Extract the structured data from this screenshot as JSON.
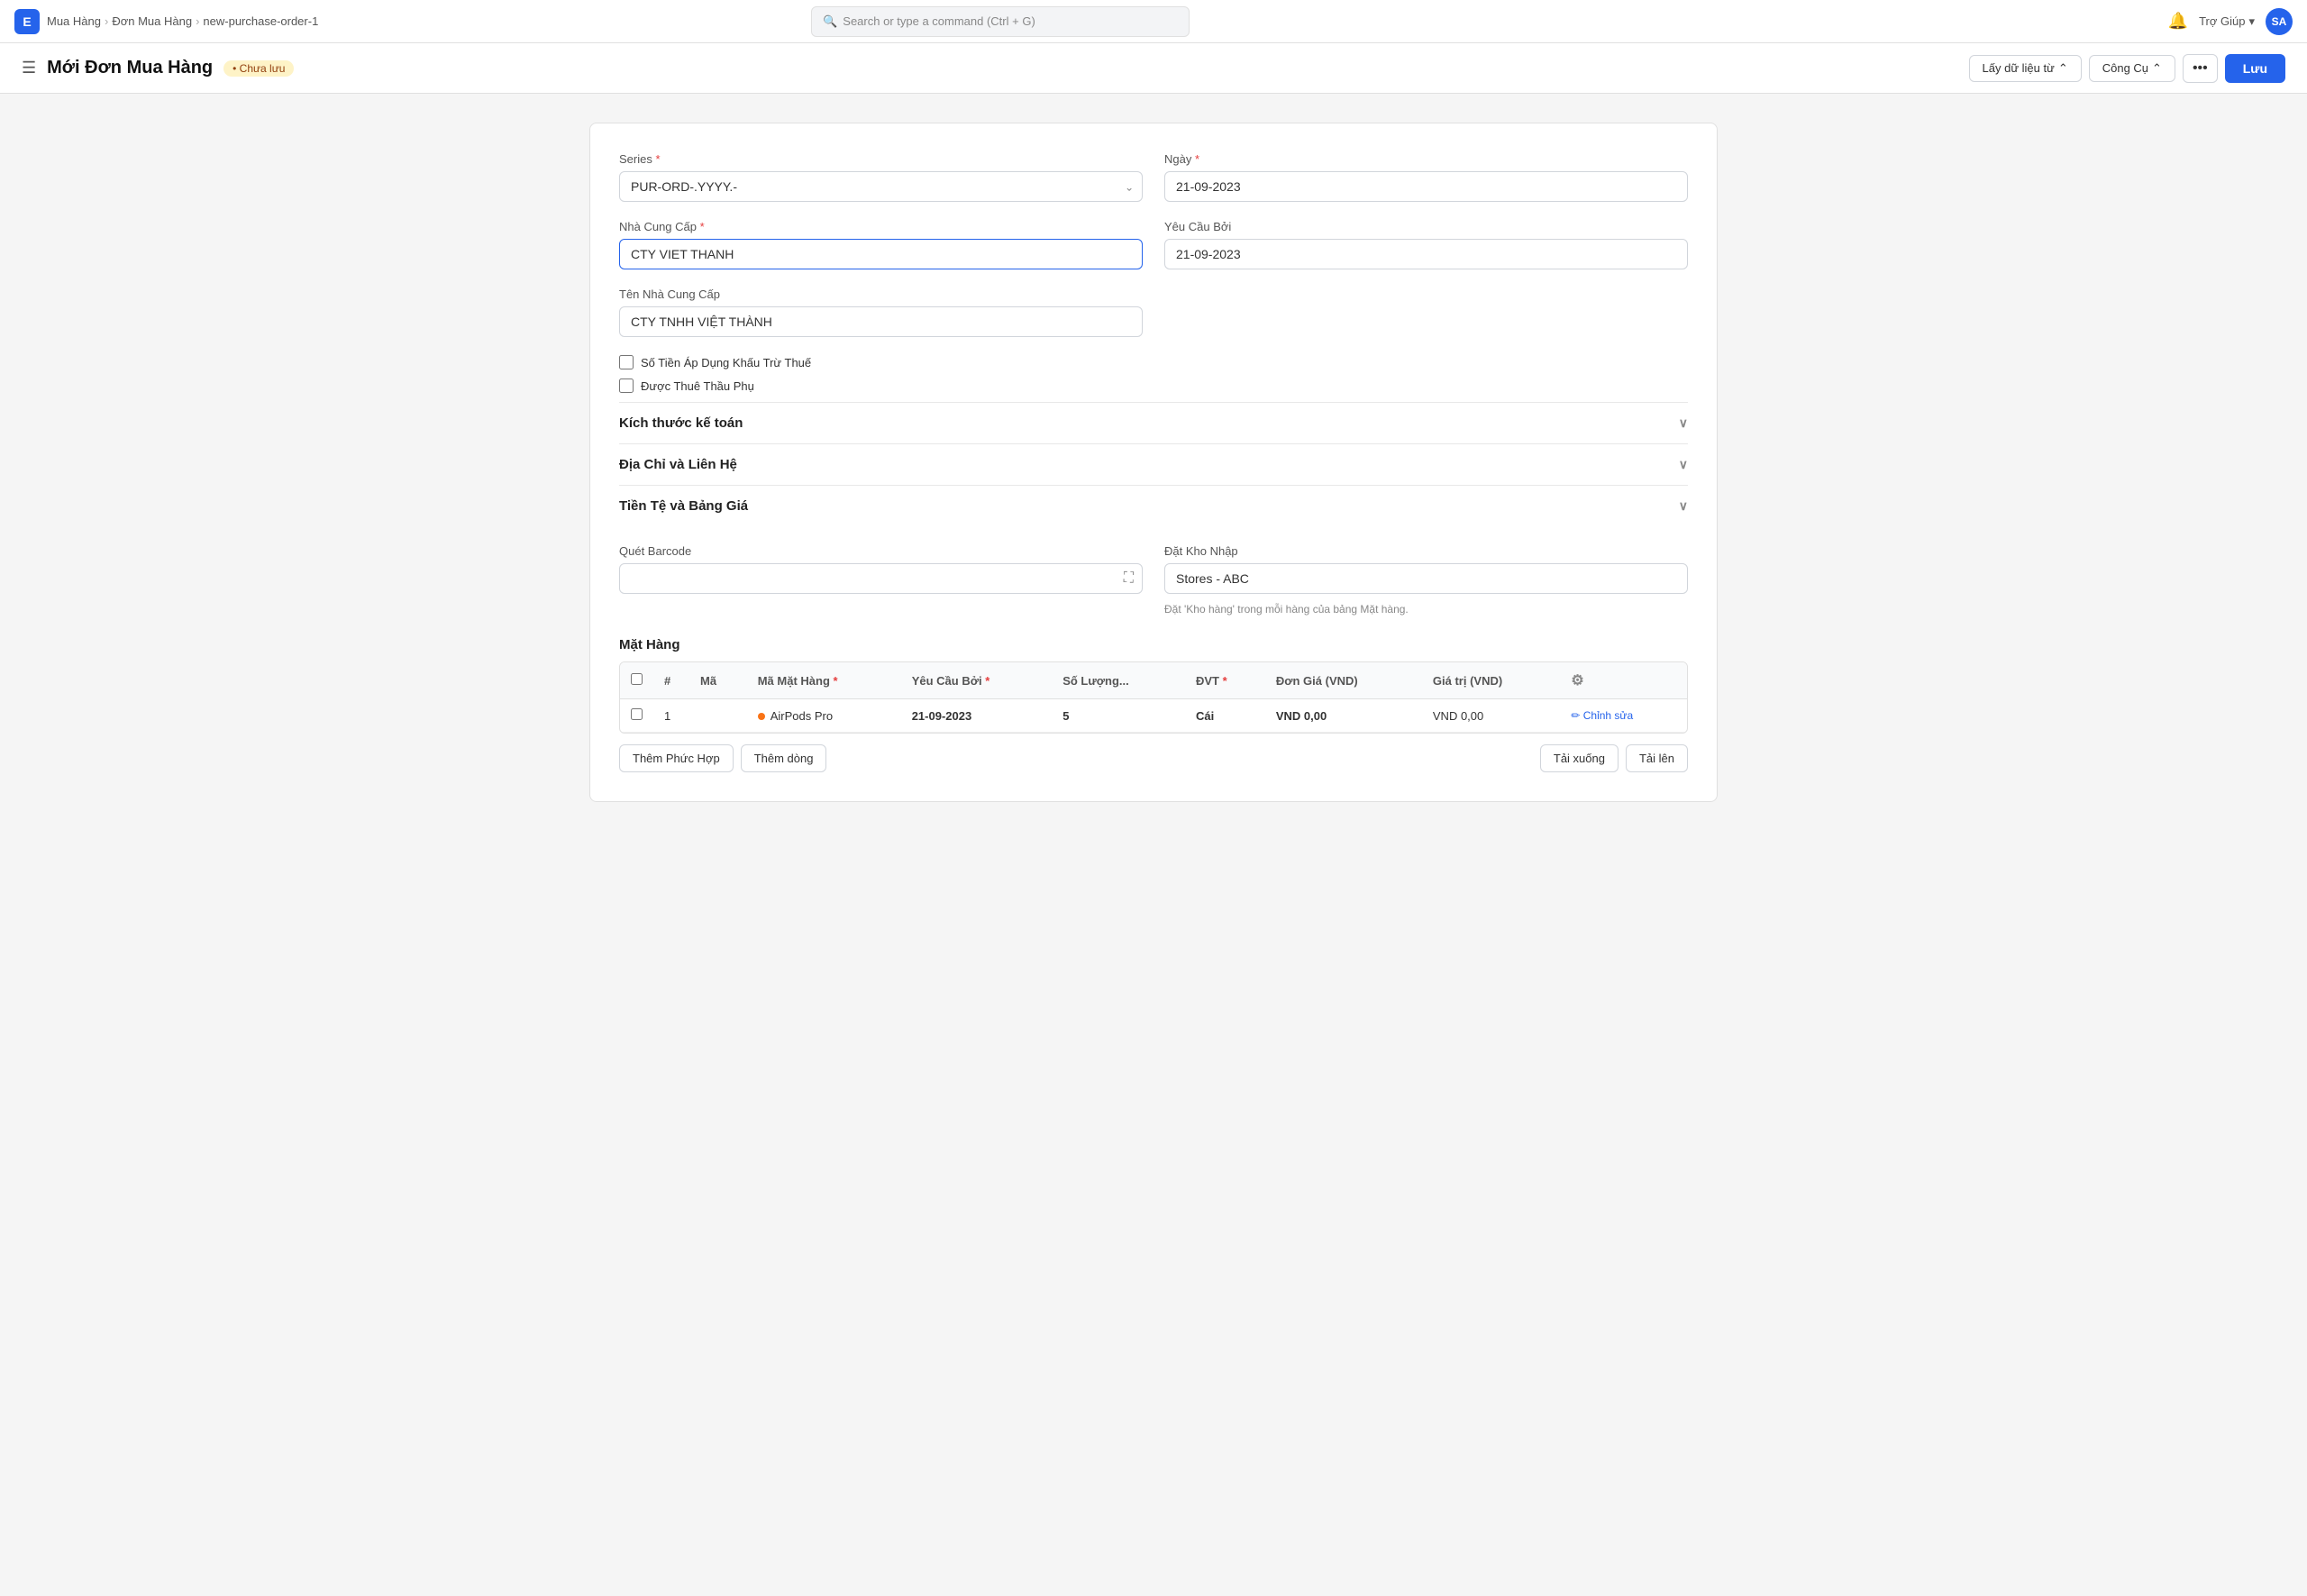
{
  "nav": {
    "logo": "E",
    "breadcrumbs": [
      "Mua Hàng",
      "Đơn Mua Hàng",
      "new-purchase-order-1"
    ],
    "search_placeholder": "Search or type a command (Ctrl + G)",
    "help_label": "Trợ Giúp",
    "avatar_initials": "SA"
  },
  "header": {
    "menu_icon": "☰",
    "title": "Mới Đơn Mua Hàng",
    "unsaved": "• Chưa lưu",
    "btn_data": "Lấy dữ liệu từ",
    "btn_tools": "Công Cụ",
    "btn_dots": "•••",
    "btn_save": "Lưu"
  },
  "form": {
    "series_label": "Series",
    "series_value": "PUR-ORD-.YYYY.-",
    "ngay_label": "Ngày",
    "ngay_value": "21-09-2023",
    "nha_cung_cap_label": "Nhà Cung Cấp",
    "nha_cung_cap_value": "CTY VIET THANH",
    "yeu_cau_boi_label": "Yêu Cầu Bởi",
    "yeu_cau_boi_value": "21-09-2023",
    "ten_ncc_label": "Tên Nhà Cung Cấp",
    "ten_ncc_value": "CTY TNHH VIỆT THÀNH",
    "checkbox1_label": "Số Tiền Áp Dụng Khấu Trừ Thuế",
    "checkbox2_label": "Được Thuê Thầu Phụ",
    "section1": "Kích thước kế toán",
    "section2": "Địa Chỉ và Liên Hệ",
    "section3": "Tiền Tệ và Bảng Giá",
    "barcode_label": "Quét Barcode",
    "barcode_placeholder": "",
    "kho_nhap_label": "Đặt Kho Nhập",
    "kho_nhap_value": "Stores - ABC",
    "kho_hint": "Đặt 'Kho hàng' trong mỗi hàng của bảng Mặt hàng.",
    "mat_hang_label": "Mặt Hàng"
  },
  "table": {
    "columns": [
      "",
      "#",
      "Mã",
      "Mã Mặt Hàng",
      "Yêu Cầu Bởi",
      "Số Lượng...",
      "ĐVT",
      "Đơn Giá (VND)",
      "Giá trị (VND)",
      ""
    ],
    "rows": [
      {
        "num": "1",
        "ma": "",
        "ma_mat_hang": "AirPods Pro",
        "yeu_cau_boi": "21-09-2023",
        "so_luong": "5",
        "dvt": "Cái",
        "don_gia": "VND 0,00",
        "gia_tri": "VND 0,00",
        "action": "Chỉnh sửa"
      }
    ],
    "btn_add_complex": "Thêm Phức Hợp",
    "btn_add_row": "Thêm dòng",
    "btn_download": "Tải xuống",
    "btn_upload": "Tải lên"
  }
}
